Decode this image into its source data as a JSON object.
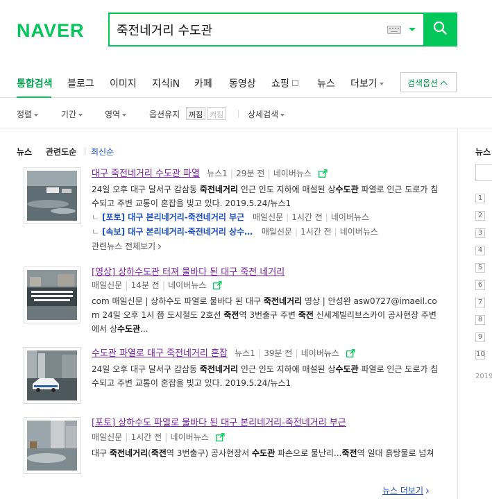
{
  "header": {
    "logo": "NAVER",
    "query": "죽전네거리 수도관"
  },
  "tabs": {
    "items": [
      "통합검색",
      "블로그",
      "이미지",
      "지식iN",
      "카페",
      "동영상",
      "쇼핑",
      "뉴스",
      "더보기"
    ],
    "search_options": "검색옵션"
  },
  "filters": {
    "sort": "정렬",
    "period": "기간",
    "area": "영역",
    "keep_option": "옵션유지",
    "off": "꺼짐",
    "on": "켜짐",
    "detail": "상세검색"
  },
  "news": {
    "heading": "뉴스",
    "sort_relevance": "관련도순",
    "sort_latest": "최신순",
    "items": [
      {
        "title": "대구 죽전네거리 수도관 파열",
        "press": "뉴스1",
        "time": "29분 전",
        "portal": "네이버뉴스",
        "desc": "24일 오후 대구 달서구 감삼동 <b>죽전네거리</b> 인근 인도 지하에 매설된 상<b>수도관</b> 파열로 인근 도로가 침수되고 주변 교통이 혼잡을 빚고 있다. 2019.5.24/뉴스1",
        "related": [
          {
            "title": "[포토] 대구 본리네거리-죽전네거리 부근",
            "press": "매일신문",
            "time": "1시간 전",
            "portal": "네이버뉴스"
          },
          {
            "title": "[속보] 대구 본리네거리-죽전네거리 상수도관",
            "press": "매일신문",
            "time": "1시간 전",
            "portal": "네이버뉴스"
          }
        ],
        "related_all": "관련뉴스 전체보기"
      },
      {
        "title": "[영상] 상하수도관 터져 물바다 된 대구 죽전 네거리",
        "press": "매일신문",
        "time": "14분 전",
        "portal": "네이버뉴스",
        "desc": "com 매일신문 | 상하수도 파열로 물바다 된 대구 <b>죽전네거리</b> 영상 | 안성완 asw0727@imaeil.com 24일 오후 1시 쯤 도시철도 2호선 <b>죽전</b>역 3번출구 주변 <b>죽전</b> 신세계빌리브스카이 공사현장 주변에서 상<b>수도관</b>..."
      },
      {
        "title": "수도관 파열로 대구 죽전네거리 혼잡",
        "press": "뉴스1",
        "time": "39분 전",
        "portal": "네이버뉴스",
        "desc": "24일 오후 대구 달서구 감삼동 <b>죽전네거리</b> 인근 인도 지하에 매설된 상<b>수도관</b> 파열로 인근 도로가 침수되고 주변 교통이 혼잡을 빚고 있다. 2019.5.24/뉴스1"
      },
      {
        "title": "[포토] 상하수도 파열로 물바다 된 대구 본리네거리-죽전네거리 부근",
        "press": "매일신문",
        "time": "1시간 전",
        "portal": "네이버뉴스",
        "desc": "대구 <b>죽전네거리</b>(<b>죽전</b>역 3번출구) 공사현장서 <b>수도관</b> 파손으로 물난리...<b>죽전</b>역 일대 흙탕물로 넘쳐"
      }
    ],
    "more": "뉴스 더보기"
  },
  "side": {
    "heading": "뉴스",
    "ranks": [
      "1",
      "2",
      "3",
      "4",
      "5",
      "6",
      "7",
      "8",
      "9",
      "10"
    ],
    "date": "2019"
  },
  "colors": {
    "brand": "#03c75a",
    "visited": "#7a1fa2",
    "link": "#1c4fc3"
  }
}
